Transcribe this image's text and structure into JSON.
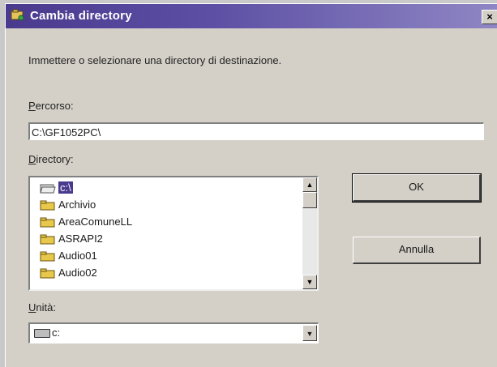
{
  "window": {
    "title": "Cambia directory",
    "close_glyph": "×"
  },
  "instruction": "Immettere o selezionare una directory di destinazione.",
  "path": {
    "label_accel": "P",
    "label_rest": "ercorso:",
    "value": "C:\\GF1052PC\\"
  },
  "directory": {
    "label_accel": "D",
    "label_rest": "irectory:",
    "items": [
      {
        "label": "c:\\",
        "selected": true,
        "icon": "open-folder-icon"
      },
      {
        "label": "Archivio",
        "selected": false,
        "icon": "folder-icon"
      },
      {
        "label": "AreaComuneLL",
        "selected": false,
        "icon": "folder-icon"
      },
      {
        "label": "ASRAPI2",
        "selected": false,
        "icon": "folder-icon"
      },
      {
        "label": "Audio01",
        "selected": false,
        "icon": "folder-icon"
      },
      {
        "label": "Audio02",
        "selected": false,
        "icon": "folder-icon"
      }
    ],
    "scroll_up_glyph": "▲",
    "scroll_down_glyph": "▼"
  },
  "buttons": {
    "ok": "OK",
    "cancel": "Annulla"
  },
  "drive": {
    "label_accel": "U",
    "label_rest": "nità:",
    "value": "c:",
    "icon": "drive-icon",
    "dropdown_glyph": "▼"
  },
  "colors": {
    "title_bar": "#4a3a8e",
    "selection": "#4a3a8e",
    "dialog_bg": "#d4d0c8"
  }
}
